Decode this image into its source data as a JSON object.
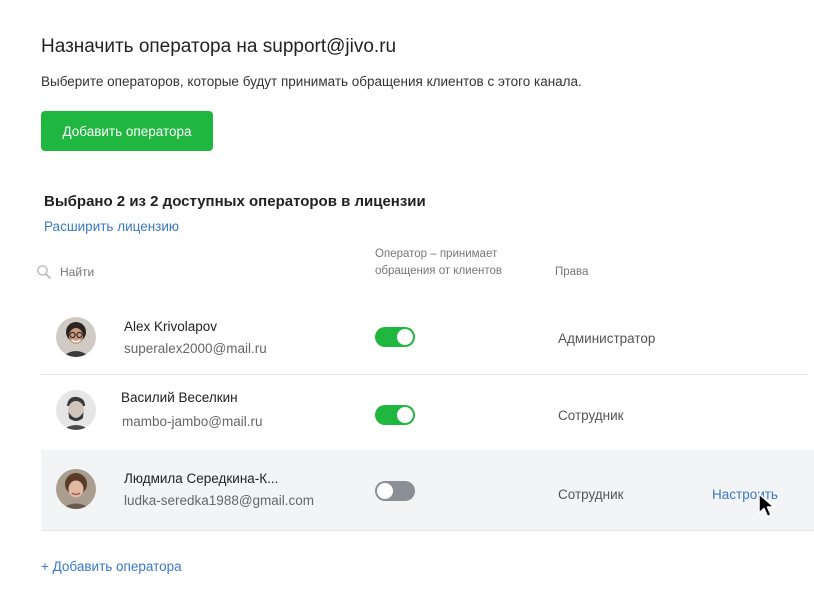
{
  "header": {
    "title": "Назначить оператора на support@jivo.ru",
    "subtitle": "Выберите операторов, которые будут принимать обращения клиентов с этого канала.",
    "add_button": "Добавить оператора"
  },
  "license": {
    "count_text": "Выбрано 2 из 2 доступных операторов в лицензии",
    "expand_link": "Расширить лицензию"
  },
  "table": {
    "search_placeholder": "Найти",
    "col_operator": "Оператор – принимает обращения от клиентов",
    "col_rights": "Права",
    "rows": [
      {
        "name": "Alex Krivolapov",
        "email": "superalex2000@mail.ru",
        "accepting": true,
        "role": "Администратор",
        "action": ""
      },
      {
        "name": "Василий Веселкин",
        "email": "mambo-jambo@mail.ru",
        "accepting": true,
        "role": "Сотрудник",
        "action": ""
      },
      {
        "name": "Людмила Середкина-К...",
        "email": "ludka-seredka1988@gmail.com",
        "accepting": false,
        "role": "Сотрудник",
        "action": "Настроить"
      }
    ]
  },
  "footer": {
    "add_link": "+ Добавить оператора"
  },
  "colors": {
    "accent_green": "#1fb73f",
    "link_blue": "#3a78c9",
    "toggle_off": "#8a8f96",
    "row_highlight": "#f2f4f6"
  },
  "icons": {
    "search": "search-icon",
    "cursor": "mouse-pointer-icon"
  }
}
